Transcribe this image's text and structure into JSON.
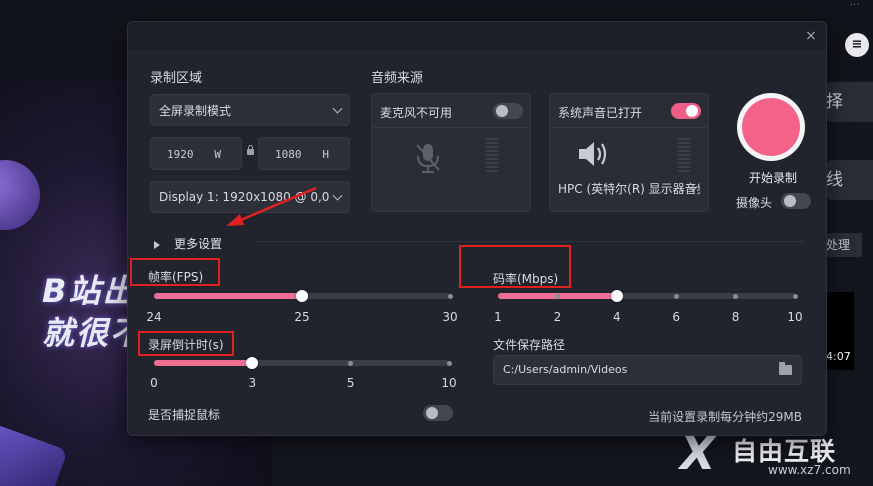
{
  "background": {
    "logo_text_line1": "B站出",
    "logo_text_line2": "就很不",
    "side_btn_1": "择",
    "side_btn_2": "线",
    "side_small_btn": "处理",
    "thumb_time": "4:07",
    "watermark_title": "自由互联",
    "watermark_url": "www.xz7.com"
  },
  "dialog": {
    "close_icon": "×",
    "record_area": {
      "title": "录制区域",
      "mode_select": "全屏录制模式",
      "width_value": "1920",
      "width_unit": "W",
      "height_value": "1080",
      "height_unit": "H",
      "display_select": "Display 1: 1920x1080 @ 0,0"
    },
    "audio_source": {
      "title": "音频来源",
      "mic_label": "麦克风不可用",
      "mic_enabled": false,
      "system_label": "系统声音已打开",
      "system_enabled": true,
      "system_device": "HPC (英特尔(R) 显示器音频)"
    },
    "record_button": {
      "label": "开始录制",
      "color": "#f4628a"
    },
    "camera": {
      "label": "摄像头",
      "enabled": false
    },
    "more_settings": "更多设置",
    "fps": {
      "label": "帧率(FPS)",
      "ticks": [
        "24",
        "25",
        "30"
      ],
      "selected_index": 1
    },
    "bitrate": {
      "label": "码率(Mbps)",
      "ticks": [
        "1",
        "2",
        "4",
        "6",
        "8",
        "10"
      ],
      "selected_index": 2
    },
    "countdown": {
      "label": "录屏倒计时(s)",
      "ticks": [
        "0",
        "3",
        "5",
        "10"
      ],
      "selected_index": 1
    },
    "save_path": {
      "label": "文件保存路径",
      "value": "C:/Users/admin/Videos"
    },
    "capture_mouse": {
      "label": "是否捕捉鼠标",
      "enabled": false
    },
    "size_estimate": "当前设置录制每分钟约29MB"
  },
  "annotation_color": "#e0211f",
  "accent_color": "#ef6f92"
}
